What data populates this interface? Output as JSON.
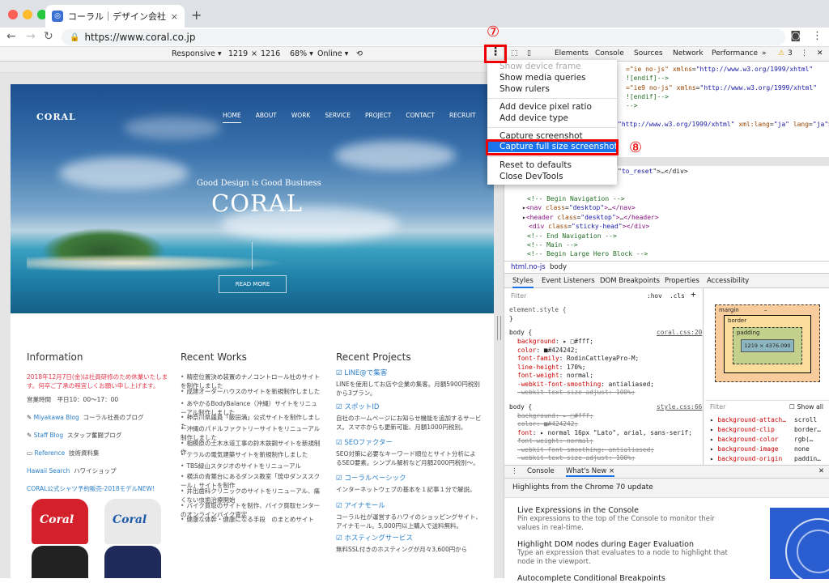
{
  "browser": {
    "tab_title": "コーラル｜デザイン会社｜ホーム",
    "tab_close": "×",
    "new_tab": "+",
    "url": "https://www.coral.co.jp"
  },
  "device_toolbar": {
    "device": "Responsive ▾",
    "width": "1219",
    "times": "×",
    "height": "1216",
    "zoom": "68% ▾",
    "network": "Online ▾"
  },
  "site": {
    "logo": "CORAL",
    "menu": [
      "HOME",
      "ABOUT",
      "WORK",
      "SERVICE",
      "PROJECT",
      "CONTACT",
      "RECRUIT"
    ],
    "tagline": "Good Design is Good Business",
    "hero_title": "CORAL",
    "read_more": "READ MORE",
    "info": {
      "heading": "Information",
      "notice": "2018年12月7日(金)は社員研修のため休業いたします。何卒ご了承の程宜しくお願い申し上げます。",
      "hours": "営業時間　平日10：00～17：00",
      "blog1_link": "Miyakawa Blog",
      "blog1_desc": "コーラル社長のブログ",
      "blog2_link": "Staff Blog",
      "blog2_desc": "スタッフ奮闘ブログ",
      "ref_link": "Reference",
      "ref_desc": "技術資料集",
      "hawaii_link": "Hawaii Search",
      "hawaii_desc": "ハワイショップ",
      "shirt_link": "CORAL公式シャツ予約販売-2018モデルNEW!",
      "shirt_word": "Coral"
    },
    "recent_works": {
      "heading": "Recent Works",
      "items": [
        "精密位置決め装置のナノコントロール社のサイトを制作しました",
        "成建オーダーハウスのサイトを新規制作しました",
        "あやかるBodyBalance（沖縄）サイトをリニューアル制作しました",
        "神奈川県議員「飯田満」公式サイトを制作しました",
        "沖縄のパドルファクトリーサイトをリニューアル制作しました",
        "相模原の土木水道工事の鈴木鉄鋼サイトを新規制作",
        "テラルの電気建築サイトを新規制作しました",
        "TBS緑山スタジオのサイトをリニューアル",
        "横浜の青葉台にあるダンス教室「琉中ダンススクール」サイトを制作",
        "井出歯科クリニックのサイトをリニューアル、痛くない虫歯治療開始",
        "バイク買取のサイトを制作、バイク買取センターのオンラインバイク査定",
        "健康な体幹・健康になる手段　のまとめサイト"
      ]
    },
    "recent_projects": {
      "heading": "Recent Projects",
      "items": [
        {
          "title": "LINE@で集客",
          "desc": "LINEを使用してお店や企業の集客。月額5900円税別から3プラン。"
        },
        {
          "title": "スポットID",
          "desc": "自社のホームページにお知らせ機能を追加するサービス。スマホからも更新可能、月額1000円税別。"
        },
        {
          "title": "SEOファクター",
          "desc": "SEO対策に必要なキーワード順位とサイト分析によるSEO要素。シンプル解析など月額2000円税別～。"
        },
        {
          "title": "コーラルベーシック",
          "desc": "インターネットウェブの基本を１記事１分で解説。"
        },
        {
          "title": "アイナモール",
          "desc": "コーラル社が運営するハワイのショッピングサイト、アイナモール。5,000円以上購入で送料無料。"
        },
        {
          "title": "ホスティングサービス",
          "desc": "無料SSL付きのホスティングが月々3,600円から"
        }
      ]
    }
  },
  "devtools": {
    "tabs": [
      "Elements",
      "Console",
      "Sources",
      "Network",
      "Performance",
      "»"
    ],
    "warning_count": "3",
    "breadcrumbs": [
      "html.no-js",
      "body"
    ],
    "sub_tabs": [
      "Styles",
      "Event Listeners",
      "DOM Breakpoints",
      "Properties",
      "Accessibility"
    ],
    "filter_placeholder": "Filter",
    "hov": ":hov",
    "cls": ".cls",
    "element_style": "element.style {",
    "box_labels": {
      "margin": "margin",
      "border": "border",
      "padding": "padding",
      "content": "1219 × 4376.090",
      "dash": "–"
    },
    "computed_filter": "Filter",
    "show_all": "Show all",
    "computed": [
      {
        "name": "background-attach…",
        "value": "scroll"
      },
      {
        "name": "background-clip",
        "value": "border…"
      },
      {
        "name": "background-color",
        "value": "rgb(…"
      },
      {
        "name": "background-image",
        "value": "none"
      },
      {
        "name": "background-origin",
        "value": "paddin…"
      }
    ],
    "drawer_tabs": [
      "Console",
      "What's New ×"
    ],
    "whats_new_header": "Highlights from the Chrome 70 update",
    "whats_new": [
      {
        "title": "Live Expressions in the Console",
        "desc": "Pin expressions to the top of the Console to monitor their values in real-time."
      },
      {
        "title": "Highlight DOM nodes during Eager Evaluation",
        "desc": "Type an expression that evaluates to a node to highlight that node in the viewport."
      },
      {
        "title": "Autocomplete Conditional Breakpoints",
        "desc": ""
      }
    ]
  },
  "overflow_menu": {
    "items": [
      "Show device frame",
      "Show media queries",
      "Show rulers",
      "Add device pixel ratio",
      "Add device type",
      "Capture screenshot",
      "Capture full size screenshot",
      "Reset to defaults",
      "Close DevTools"
    ]
  },
  "annotations": {
    "step7": "⑦",
    "step8": "⑧"
  }
}
